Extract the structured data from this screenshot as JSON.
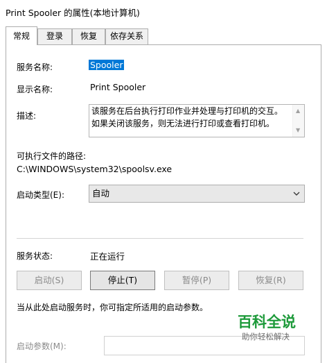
{
  "window": {
    "title": "Print Spooler 的属性(本地计算机)"
  },
  "tabs": [
    {
      "label": "常规",
      "active": true
    },
    {
      "label": "登录",
      "active": false
    },
    {
      "label": "恢复",
      "active": false
    },
    {
      "label": "依存关系",
      "active": false
    }
  ],
  "general": {
    "service_name_label": "服务名称:",
    "service_name_value": "Spooler",
    "display_name_label": "显示名称:",
    "display_name_value": "Print Spooler",
    "description_label": "描述:",
    "description_value": "该服务在后台执行打印作业并处理与打印机的交互。如果关闭该服务，则无法进行打印或查看打印机。",
    "exe_path_label": "可执行文件的路径:",
    "exe_path_value": "C:\\WINDOWS\\system32\\spoolsv.exe",
    "startup_type_label": "启动类型(E):",
    "startup_type_value": "自动",
    "status_label": "服务状态:",
    "status_value": "正在运行",
    "buttons": {
      "start": "启动(S)",
      "stop": "停止(T)",
      "pause": "暂停(P)",
      "resume": "恢复(R)"
    },
    "hint_text": "当从此处启动服务时，你可指定所适用的启动参数。",
    "start_params_label": "启动参数(M):",
    "start_params_value": ""
  },
  "watermark": {
    "title": "百科全说",
    "subtitle": "助你轻松解决"
  },
  "colors": {
    "selection": "#0078d7",
    "watermark": "#1d9a3a"
  }
}
